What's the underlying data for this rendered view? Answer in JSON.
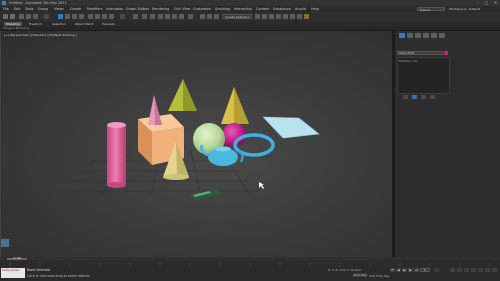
{
  "window": {
    "title": "Untitled - Autodesk 3ds Max 2021",
    "minimize": "–",
    "maximize": "□",
    "close": "✕"
  },
  "menu": [
    "File",
    "Edit",
    "Tools",
    "Group",
    "Views",
    "Create",
    "Modifiers",
    "Animation",
    "Graph Editors",
    "Rendering",
    "Civil View",
    "Customize",
    "Scripting",
    "Interactive",
    "Content",
    "Substance",
    "Arnold",
    "Help"
  ],
  "signin": "Sign In",
  "workspaces": "Workspaces: Default",
  "toolbar": {
    "selection_set_placeholder": "Create Selection Se"
  },
  "ribbon": {
    "tabs": [
      "Modeling",
      "Freeform",
      "Selection",
      "Object Paint",
      "Populate"
    ],
    "panel_label": "Polygon Modeling"
  },
  "viewport": {
    "label": "[+] [Perspective ] [Standard ] [Default Shading ]"
  },
  "command_panel": {
    "object_name": "Teapot001",
    "swatch_color": "#c81e7a",
    "modifier_list": "Modifier List"
  },
  "timeline": {
    "position": "0 / 100",
    "progress": 0.0
  },
  "status": {
    "maxscript": "MAXScript Mini",
    "selection": "None Selected",
    "prompt": "Click or click-and-drag to select objects",
    "coords": "X:   Y:   Z:   Grid = 10.0cm",
    "addtime": "Add Time Tag",
    "autokey": "Auto Key",
    "setkey": "Set Key",
    "frame": "0",
    "play_icons": [
      "prev-key-icon",
      "prev-frame-icon",
      "play-icon",
      "next-frame-icon",
      "next-key-icon"
    ]
  },
  "colors": {
    "cylinder": "#e0609a",
    "box": "#f2b07a",
    "cone_pink": "#e89ab8",
    "cone_green": "#b3bf3a",
    "cone_yellow": "#d9c04a",
    "cone_cream": "#e2d68c",
    "sphere_green": "#b5d89a",
    "sphere_magenta": "#c0188a",
    "torus": "#3fb0e6",
    "teapot": "#49b8e0",
    "plane": "#b9e2ef",
    "accent_pink": "#c81e7a"
  }
}
